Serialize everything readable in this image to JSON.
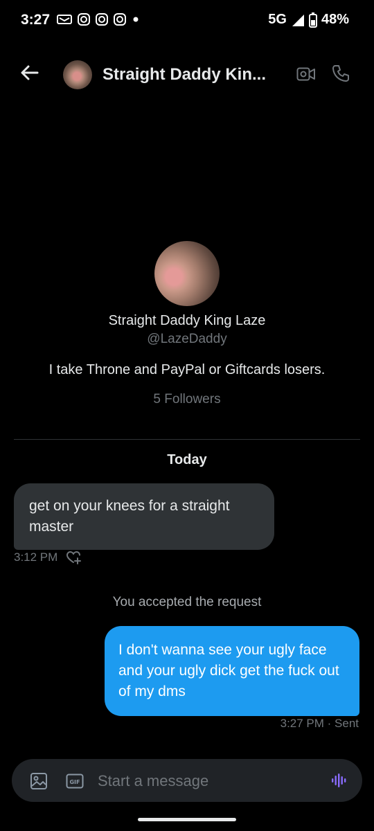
{
  "status_bar": {
    "time": "3:27",
    "network": "5G",
    "battery": "48%",
    "icons": [
      "notification-icon",
      "instagram-icon",
      "instagram-icon",
      "instagram-icon",
      "dot-icon",
      "signal-icon",
      "battery-icon"
    ]
  },
  "header": {
    "title": "Straight Daddy Kin...",
    "icons": [
      "back-arrow-icon",
      "video-call-icon",
      "phone-call-icon"
    ]
  },
  "profile": {
    "name": "Straight Daddy King Laze",
    "handle": "@LazeDaddy",
    "bio": "I take Throne and PayPal or Giftcards losers.",
    "followers": "5 Followers"
  },
  "conversation": {
    "date_label": "Today",
    "incoming": {
      "text": "get on your knees for a straight master",
      "time": "3:12 PM"
    },
    "system_note": "You accepted the request",
    "outgoing": {
      "text": "I don't wanna see your ugly face and your ugly dick get the fuck out of my dms",
      "meta": "3:27 PM · Sent"
    }
  },
  "composer": {
    "placeholder": "Start a message",
    "icons": [
      "image-icon",
      "gif-icon",
      "voice-icon"
    ]
  },
  "colors": {
    "background": "#000000",
    "accent": "#1d9bf0",
    "incoming_bubble": "#2f3336",
    "muted_text": "#71767b",
    "voice": "#8a6cff"
  }
}
